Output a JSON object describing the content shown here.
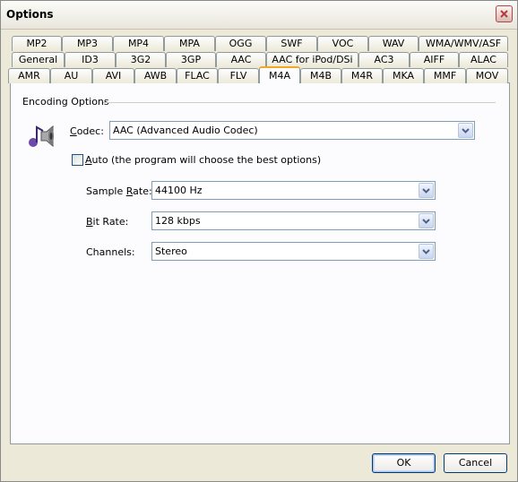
{
  "window": {
    "title": "Options"
  },
  "tabs": {
    "row1": [
      "MP2",
      "MP3",
      "MP4",
      "MPA",
      "OGG",
      "SWF",
      "VOC",
      "WAV",
      "WMA/WMV/ASF"
    ],
    "row2": [
      "General",
      "ID3",
      "3G2",
      "3GP",
      "AAC",
      "AAC for iPod/DSi",
      "AC3",
      "AIFF",
      "ALAC"
    ],
    "row3": [
      "AMR",
      "AU",
      "AVI",
      "AWB",
      "FLAC",
      "FLV",
      "M4A",
      "M4B",
      "M4R",
      "MKA",
      "MMF",
      "MOV"
    ],
    "active": "M4A"
  },
  "encoding": {
    "group_title": "Encoding Options",
    "codec_label": "Codec:",
    "codec_value": "AAC (Advanced Audio Codec)",
    "auto_label": "Auto (the program will choose the best options)",
    "auto_checked": false,
    "sample_rate_label": "Sample Rate:",
    "sample_rate_value": "44100 Hz",
    "bit_rate_label": "Bit Rate:",
    "bit_rate_value": "128 kbps",
    "channels_label": "Channels:",
    "channels_value": "Stereo"
  },
  "buttons": {
    "ok": "OK",
    "cancel": "Cancel"
  },
  "colors": {
    "active_tab_accent": "#f4a627",
    "close_button": "#c0434b"
  }
}
